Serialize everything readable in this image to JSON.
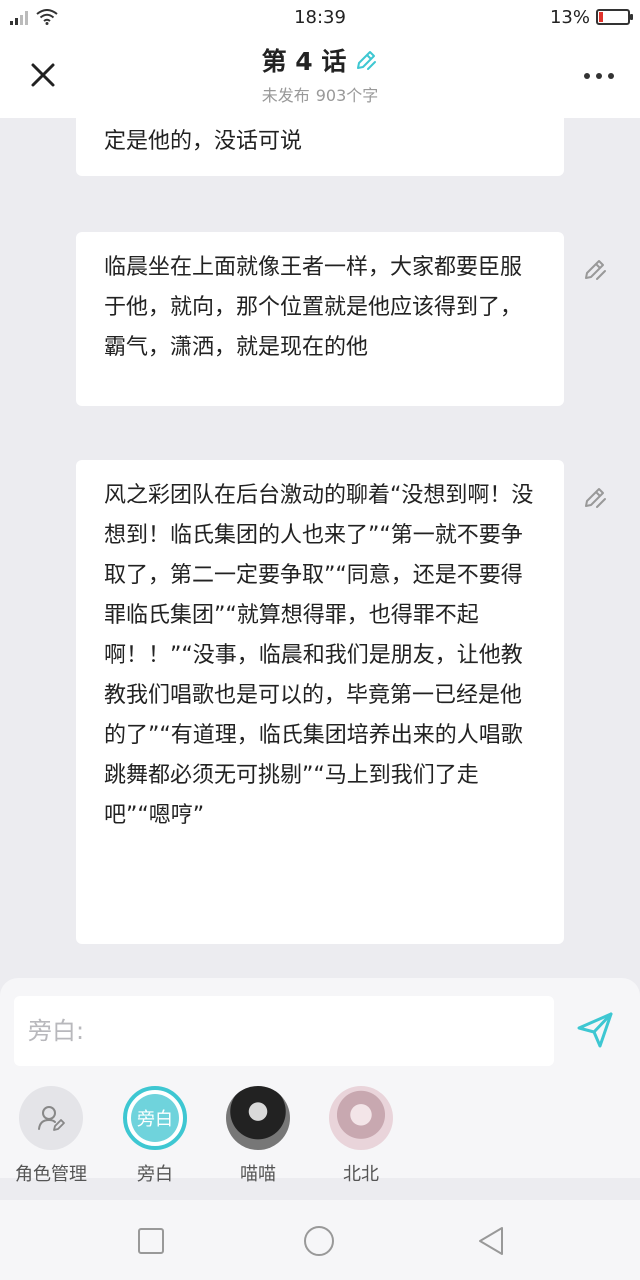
{
  "status_bar": {
    "time": "18:39",
    "battery_percent": "13%",
    "battery_level": 0.13,
    "signal_icon": "signal-icon",
    "wifi_icon": "wifi-icon",
    "battery_color": "#e0332c"
  },
  "header": {
    "title": "第 4 话",
    "status": "未发布",
    "word_count": "903个字",
    "close_icon": "close-icon",
    "edit_icon": "pencil-icon",
    "more_icon": "more-dots-icon",
    "accent_color": "#3ec7d2"
  },
  "messages": [
    {
      "text": "定是他的，没话可说"
    },
    {
      "text": "临晨坐在上面就像王者一样，大家都要臣服于他，就向，那个位置就是他应该得到了，霸气，潇洒，就是现在的他"
    },
    {
      "text": "风之彩团队在后台激动的聊着“没想到啊！没想到！临氏集团的人也来了”“第一就不要争取了，第二一定要争取”“同意，还是不要得罪临氏集团”“就算想得罪，也得罪不起啊！！”“没事，临晨和我们是朋友，让他教教我们唱歌也是可以的，毕竟第一已经是他的了”“有道理，临氏集团培养出来的人唱歌跳舞都必须无可挑剔”“马上到我们了走吧”“嗯哼”"
    }
  ],
  "composer": {
    "placeholder": "旁白:",
    "send_icon": "send-icon"
  },
  "roles": [
    {
      "label": "角色管理",
      "avatar_text": "",
      "icon": "role-manage-icon"
    },
    {
      "label": "旁白",
      "avatar_text": "旁白",
      "selected": true
    },
    {
      "label": "喵喵",
      "avatar_text": ""
    },
    {
      "label": "北北",
      "avatar_text": ""
    }
  ],
  "nav": {
    "recent_icon": "square-icon",
    "home_icon": "circle-icon",
    "back_icon": "triangle-back-icon"
  }
}
